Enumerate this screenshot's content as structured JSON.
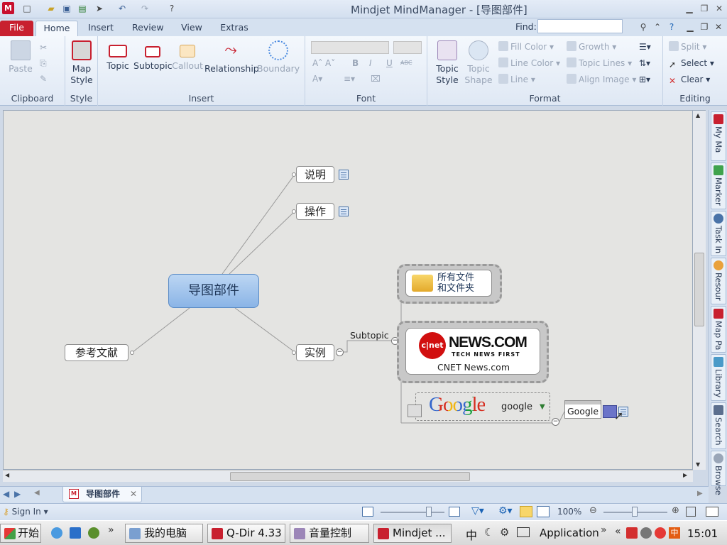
{
  "window": {
    "title": "Mindjet MindManager - [导图部件]",
    "find_label": "Find:"
  },
  "tabs": [
    "File",
    "Home",
    "Insert",
    "Review",
    "View",
    "Extras"
  ],
  "ribbon": {
    "clipboard": {
      "label": "Clipboard",
      "paste": "Paste"
    },
    "style": {
      "label": "Style",
      "map_style": "Map",
      "map_style2": "Style"
    },
    "insert": {
      "label": "Insert",
      "topic": "Topic",
      "subtopic": "Subtopic",
      "callout": "Callout",
      "relationship": "Relationship",
      "boundary": "Boundary"
    },
    "font": {
      "label": "Font",
      "bold": "B",
      "italic": "I",
      "underline": "U",
      "strike": "ABC"
    },
    "format": {
      "label": "Format",
      "topic_style": "Topic",
      "topic_style2": "Style",
      "topic_shape": "Topic",
      "topic_shape2": "Shape",
      "fill_color": "Fill Color",
      "line_color": "Line Color",
      "line": "Line",
      "growth": "Growth",
      "topic_lines": "Topic Lines",
      "align_image": "Align Image"
    },
    "editing": {
      "label": "Editing",
      "split": "Split",
      "select": "Select",
      "clear": "Clear"
    }
  },
  "map": {
    "central": "导图部件",
    "topics": {
      "shuoming": "说明",
      "caozuo": "操作",
      "shili": "实例",
      "cankao": "参考文献"
    },
    "subtopic_label": "Subtopic",
    "folder_text1": "所有文件",
    "folder_text2": "和文件夹",
    "cnet_logo_main": "NEWS.COM",
    "cnet_logo_sub": "TECH NEWS FIRST",
    "cnet_logo_badge": "c|net",
    "cnet_caption": "CNET News.com",
    "google_logo": "Google",
    "google_text": "google",
    "google_small": "Google"
  },
  "sidebar": [
    "My Ma",
    "Marker",
    "Task In",
    "Resour",
    "Map Pa",
    "Library",
    "Search",
    "Browse"
  ],
  "docbar": {
    "tab": "导图部件"
  },
  "status": {
    "sign_in": "Sign In",
    "zoom": "100%"
  },
  "taskbar": {
    "start": "开始",
    "items": [
      "我的电脑",
      "Q-Dir 4.33",
      "音量控制",
      "Mindjet ..."
    ],
    "ime": "中",
    "application": "Application",
    "clock": "15:01"
  }
}
